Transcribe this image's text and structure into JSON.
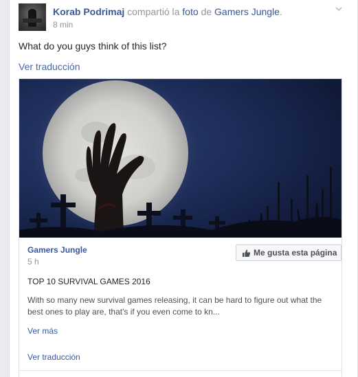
{
  "post": {
    "author": "Korab Podrimaj",
    "shared_text": "compartió la",
    "photo_link": "foto",
    "of_text": "de",
    "source_page": "Gamers Jungle",
    "period": ".",
    "time": "8 min",
    "message": "What do you guys think of this list?",
    "translate_link": "Ver traducción"
  },
  "shared": {
    "page_name": "Gamers Jungle",
    "page_time": "5 h",
    "like_button": "Me gusta esta página",
    "title": "TOP 10 SURVIVAL GAMES 2016",
    "body": "With so many new survival games releasing, it can be hard to figure out what the best ones to play are, that's if you even come to kn...",
    "see_more": "Ver más",
    "translate_link": "Ver traducción"
  },
  "icons": {
    "menu": "chevron-down-icon",
    "like": "thumbs-up-icon"
  },
  "colors": {
    "link": "#365899",
    "meta": "#90949c",
    "sky": "#1b2a55"
  }
}
